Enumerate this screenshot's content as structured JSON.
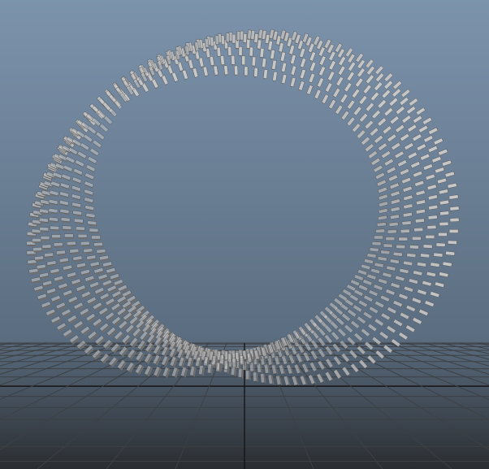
{
  "viewport": {
    "background_top_color": "#7c93ac",
    "background_mid_color": "#5b6d80",
    "background_bottom_color": "#2a2d31",
    "grid_line_color": "#3d4145",
    "grid_axis_color": "#151515",
    "grid_visible": true
  },
  "model": {
    "name": "twisted-torus-of-blocks",
    "block_color": "#c8c8c8",
    "block_shadow_color": "#6f6f6f",
    "ring_segments": 120,
    "blocks_per_segment": 7,
    "twist_turns": 1.0
  }
}
